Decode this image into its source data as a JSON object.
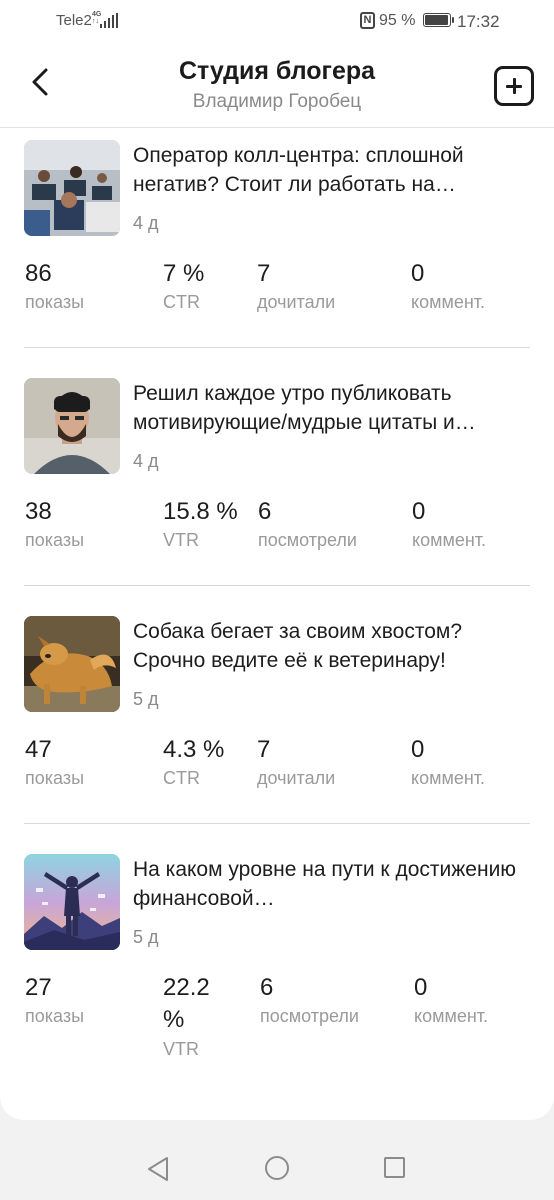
{
  "status_bar": {
    "carrier": "Tele2",
    "network": "4G",
    "battery_percent": "95 %",
    "time": "17:32"
  },
  "header": {
    "title": "Студия блогера",
    "subtitle": "Владимир Горобец",
    "back_icon": "back-arrow-icon",
    "add_icon": "add-square-icon"
  },
  "posts": [
    {
      "title": "Оператор колл-центра: сплошной негатив? Стоит ли работать на…",
      "age": "4 д",
      "stats": [
        {
          "value": "86",
          "label": "показы"
        },
        {
          "value": "7 %",
          "label": "CTR"
        },
        {
          "value": "7",
          "label": "дочитали"
        },
        {
          "value": "0",
          "label": "коммент."
        }
      ]
    },
    {
      "title": "Решил каждое утро публиковать мотивирующие/мудрые цитаты и…",
      "age": "4 д",
      "stats": [
        {
          "value": "38",
          "label": "показы"
        },
        {
          "value": "15.8 %",
          "label": "VTR"
        },
        {
          "value": "6",
          "label": "посмотрели"
        },
        {
          "value": "0",
          "label": "коммент."
        }
      ]
    },
    {
      "title": "Собака бегает за своим хвостом? Срочно ведите её к ветеринару!",
      "age": "5 д",
      "stats": [
        {
          "value": "47",
          "label": "показы"
        },
        {
          "value": "4.3 %",
          "label": "CTR"
        },
        {
          "value": "7",
          "label": "дочитали"
        },
        {
          "value": "0",
          "label": "коммент."
        }
      ]
    },
    {
      "title": "На каком уровне на пути к достижению финансовой…",
      "age": "5 д",
      "stats": [
        {
          "value": "27",
          "label": "показы"
        },
        {
          "value": "22.2 %",
          "label": "VTR"
        },
        {
          "value": "6",
          "label": "посмотрели"
        },
        {
          "value": "0",
          "label": "коммент."
        }
      ]
    }
  ],
  "nav": {
    "back_icon": "triangle-back-icon",
    "home_icon": "circle-home-icon",
    "recent_icon": "square-recents-icon"
  }
}
